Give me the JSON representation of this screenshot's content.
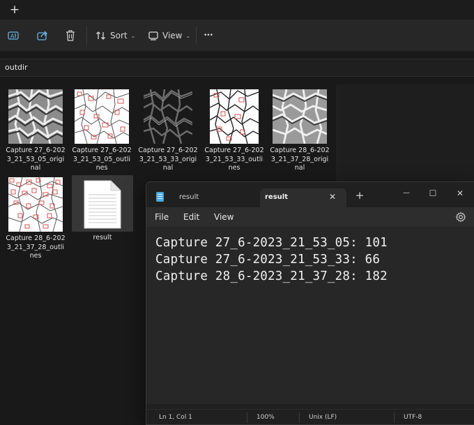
{
  "explorer": {
    "tabbar": {
      "new_tab_glyph": "+"
    },
    "toolbar": {
      "sort_label": "Sort",
      "view_label": "View",
      "more_glyph": "•••",
      "caret_glyph": "⌄"
    },
    "address": {
      "path": "outdir"
    },
    "files": [
      {
        "name": "Capture 27_6-2023_21_53_05_original",
        "thumb": "gray-texture"
      },
      {
        "name": "Capture 27_6-2023_21_53_05_outlines",
        "thumb": "outlines"
      },
      {
        "name": "Capture 27_6-2023_21_53_33_original",
        "thumb": "dark-texture"
      },
      {
        "name": "Capture 27_6-2023_21_53_33_outlines",
        "thumb": "outlines"
      },
      {
        "name": "Capture 28_6-2023_21_37_28_original",
        "thumb": "gray-texture"
      },
      {
        "name": "Capture 28_6-2023_21_37_28_outlines",
        "thumb": "outlines"
      },
      {
        "name": "result",
        "thumb": "text-document"
      }
    ]
  },
  "notepad": {
    "tabs": [
      {
        "label": "result"
      },
      {
        "label": "result",
        "active": true
      }
    ],
    "close_glyph": "✕",
    "new_tab_glyph": "+",
    "window_buttons": {
      "minimize": "—",
      "maximize": "☐",
      "close": "✕"
    },
    "menu": {
      "file": "File",
      "edit": "Edit",
      "view": "View"
    },
    "content_lines": [
      "Capture 27_6-2023_21_53_05: 101",
      "Capture 27_6-2023_21_53_33: 66",
      "Capture 28_6-2023_21_37_28: 182"
    ],
    "status": {
      "position": "Ln 1, Col 1",
      "zoom": "100%",
      "line_ending": "Unix (LF)",
      "encoding": "UTF-8"
    }
  },
  "colors": {
    "background": "#191919",
    "toolbar": "#272727",
    "notepad_body": "#272727",
    "notepad_icon": "#4aa8de",
    "outline_red": "#d9534f"
  }
}
